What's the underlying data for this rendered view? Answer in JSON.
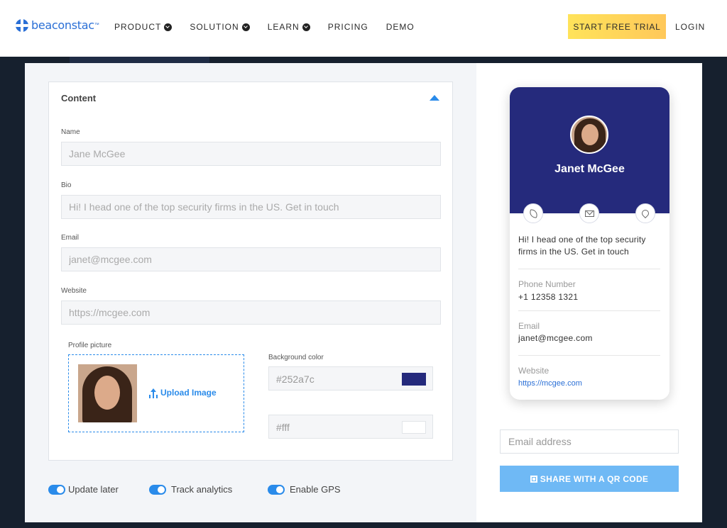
{
  "brand": {
    "name": "beaconstac",
    "tm": "™"
  },
  "nav": {
    "items": [
      {
        "label": "PRODUCT",
        "has_dropdown": true
      },
      {
        "label": "SOLUTION",
        "has_dropdown": true
      },
      {
        "label": "LEARN",
        "has_dropdown": true
      },
      {
        "label": "PRICING",
        "has_dropdown": false
      },
      {
        "label": "DEMO",
        "has_dropdown": false
      }
    ],
    "trial_label": "START FREE TRIAL",
    "login_label": "LOGIN"
  },
  "form": {
    "section_title": "Content",
    "name_label": "Name",
    "name_placeholder": "Jane McGee",
    "bio_label": "Bio",
    "bio_placeholder": "Hi! I head one of the top security firms in the US. Get in touch",
    "email_label": "Email",
    "email_placeholder": "janet@mcgee.com",
    "website_label": "Website",
    "website_placeholder": "https://mcgee.com",
    "profile_picture_label": "Profile picture",
    "upload_label": "Upload Image",
    "background_color_label": "Background color",
    "background_color_value": "#252a7c",
    "secondary_color_value": "#fff"
  },
  "toggles": [
    {
      "label": "Update later",
      "on": true
    },
    {
      "label": "Track analytics",
      "on": true
    },
    {
      "label": "Enable GPS",
      "on": true
    }
  ],
  "preview": {
    "name": "Janet McGee",
    "bio": "Hi! I head one of the top security firms in the US. Get in touch",
    "phone_label": "Phone Number",
    "phone_value": "+1 12358 1321",
    "email_label": "Email",
    "email_value": "janet@mcgee.com",
    "website_label": "Website",
    "website_value": "https://mcgee.com",
    "header_color": "#252a7c",
    "actions": [
      "phone-icon",
      "mail-icon",
      "location-pin-icon"
    ]
  },
  "share": {
    "email_placeholder": "Email address",
    "button_label": "SHARE WITH A QR CODE"
  },
  "colors": {
    "accent": "#2a8bea",
    "trial_button": "#ffd65a",
    "share_button": "#6fb9f5",
    "page_background": "#16202e"
  }
}
